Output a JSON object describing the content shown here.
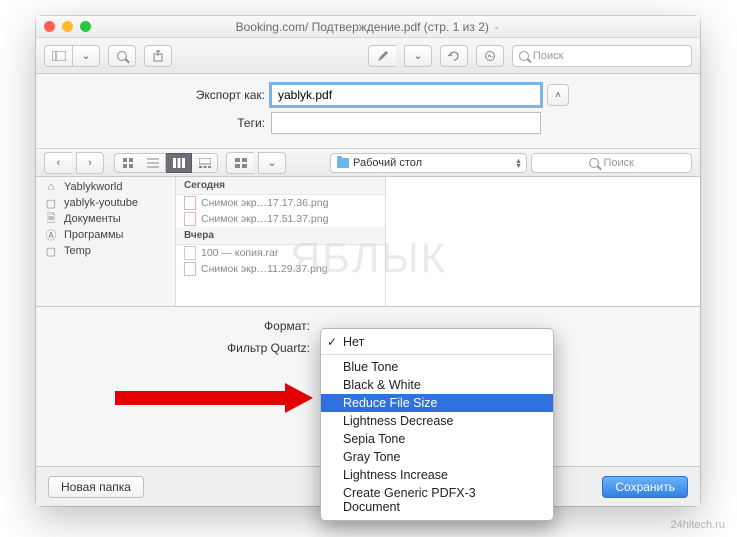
{
  "title": "Booking.com/ Подтверждение.pdf (стр. 1 из 2)",
  "toolbar": {
    "search_placeholder": "Поиск"
  },
  "export": {
    "as_label": "Экспорт как:",
    "filename": "yablyk.pdf",
    "tags_label": "Теги:"
  },
  "finder": {
    "location": "Рабочий стол",
    "search_placeholder": "Поиск",
    "sidebar": [
      {
        "icon": "home",
        "label": "Yablykworld"
      },
      {
        "icon": "folder",
        "label": "yablyk-youtube"
      },
      {
        "icon": "doc",
        "label": "Документы"
      },
      {
        "icon": "app",
        "label": "Программы"
      },
      {
        "icon": "folder",
        "label": "Temp"
      }
    ],
    "groups": [
      {
        "title": "Сегодня",
        "items": [
          "Снимок экр…17.17.36.png",
          "Снимок экр…17.51.37.png"
        ]
      },
      {
        "title": "Вчера",
        "items": [
          "100 — копия.rar",
          "Снимок экр…11.29.37.png"
        ]
      }
    ]
  },
  "format": {
    "format_label": "Формат:",
    "quartz_label": "Фильтр Quartz:"
  },
  "dropdown": {
    "items": [
      "Нет",
      "Blue Tone",
      "Black & White",
      "Reduce File Size",
      "Lightness Decrease",
      "Sepia Tone",
      "Gray Tone",
      "Lightness Increase",
      "Create Generic PDFX-3 Document"
    ],
    "checked_index": 0,
    "highlighted_index": 3
  },
  "buttons": {
    "new_folder": "Новая папка",
    "save": "Сохранить"
  },
  "watermark": {
    "center": "ЯБЛЫК",
    "site": "24hitech.ru"
  }
}
